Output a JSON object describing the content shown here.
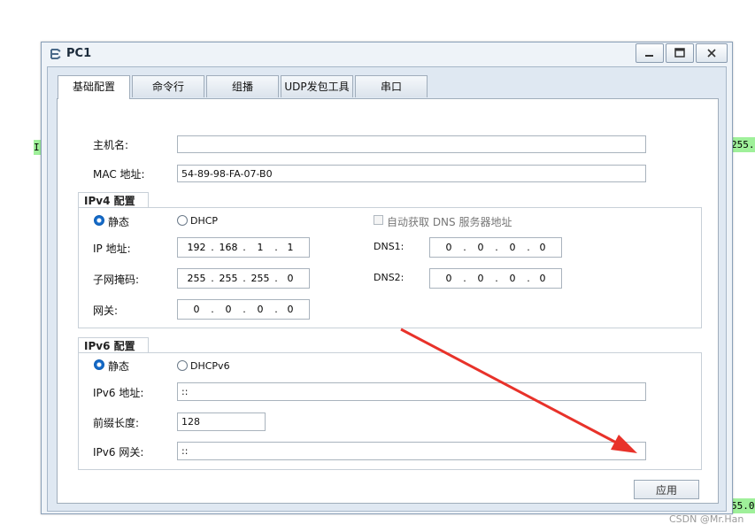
{
  "background_fragments": {
    "left_char": "I",
    "right_top": "255.",
    "right_bottom": "55.0"
  },
  "window": {
    "title": "PC1",
    "controls": {
      "minimize": "—",
      "maximize": "▭",
      "close": "X"
    }
  },
  "tabs": [
    {
      "label": "基础配置",
      "active": true
    },
    {
      "label": "命令行",
      "active": false
    },
    {
      "label": "组播",
      "active": false
    },
    {
      "label": "UDP发包工具",
      "active": false
    },
    {
      "label": "串口",
      "active": false
    }
  ],
  "host": {
    "hostname_label": "主机名:",
    "hostname_value": "",
    "mac_label": "MAC 地址:",
    "mac_value": "54-89-98-FA-07-B0"
  },
  "ipv4": {
    "title": "IPv4 配置",
    "static_label": "静态",
    "dhcp_label": "DHCP",
    "static_selected": true,
    "auto_dns_label": "自动获取 DNS 服务器地址",
    "ip_label": "IP 地址:",
    "ip": [
      "192",
      "168",
      "1",
      "1"
    ],
    "mask_label": "子网掩码:",
    "mask": [
      "255",
      "255",
      "255",
      "0"
    ],
    "gateway_label": "网关:",
    "gateway": [
      "0",
      "0",
      "0",
      "0"
    ],
    "dns1_label": "DNS1:",
    "dns1": [
      "0",
      "0",
      "0",
      "0"
    ],
    "dns2_label": "DNS2:",
    "dns2": [
      "0",
      "0",
      "0",
      "0"
    ]
  },
  "ipv6": {
    "title": "IPv6 配置",
    "static_label": "静态",
    "dhcp_label": "DHCPv6",
    "static_selected": true,
    "ip_label": "IPv6 地址:",
    "ip_value": "::",
    "prefix_label": "前缀长度:",
    "prefix_value": "128",
    "gateway_label": "IPv6 网关:",
    "gateway_value": "::"
  },
  "apply_button": "应用",
  "watermark": "CSDN @Mr.Han",
  "colors": {
    "annotation_arrow": "#e8322a",
    "radio_selected": "#1469c7",
    "background_green": "#9ff09a"
  }
}
